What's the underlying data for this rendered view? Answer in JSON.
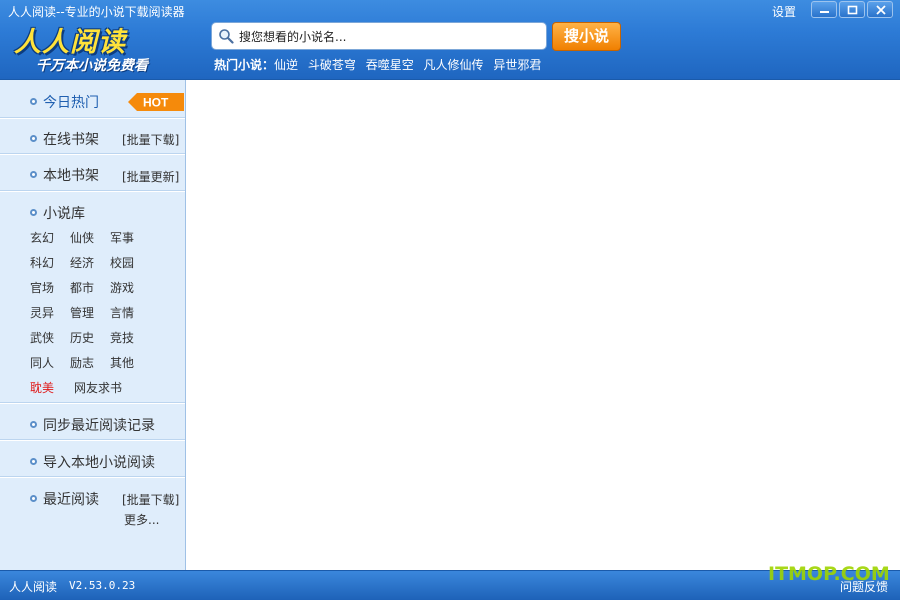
{
  "window": {
    "title": "人人阅读--专业的小说下载阅读器",
    "settings_label": "设置"
  },
  "brand": {
    "logo_text": "人人阅读",
    "slogan": "千万本小说免费看"
  },
  "search": {
    "value": "搜您想看的小说名...",
    "button_label": "搜小说"
  },
  "hot_novels": {
    "label": "热门小说：",
    "items": [
      "仙逆",
      "斗破苍穹",
      "吞噬星空",
      "凡人修仙传",
      "异世邪君"
    ]
  },
  "sidebar": {
    "today_hot": "今日热门",
    "hot_badge": "HOT",
    "online_shelf": "在线书架",
    "online_shelf_action": "[批量下载]",
    "local_shelf": "本地书架",
    "local_shelf_action": "[批量更新]",
    "library": "小说库",
    "categories": [
      "玄幻",
      "仙侠",
      "军事",
      "科幻",
      "经济",
      "校园",
      "官场",
      "都市",
      "游戏",
      "灵异",
      "管理",
      "言情",
      "武侠",
      "历史",
      "竞技",
      "同人",
      "励志",
      "其他",
      "耽美",
      "网友求书"
    ],
    "sync_history": "同步最近阅读记录",
    "import_local": "导入本地小说阅读",
    "recent_reading": "最近阅读",
    "recent_action": "[批量下载]",
    "more": "更多..."
  },
  "status": {
    "app_name": "人人阅读",
    "version": "V2.53.0.23",
    "feedback": "问题反馈"
  },
  "watermark": "ITMOP.COM",
  "colors": {
    "title_blue": "#2d7bd6",
    "sidebar_bg": "#dfedfb",
    "accent_orange": "#f07f00",
    "logo_yellow": "#ffe23a",
    "highlight_red": "#e01b1b"
  }
}
